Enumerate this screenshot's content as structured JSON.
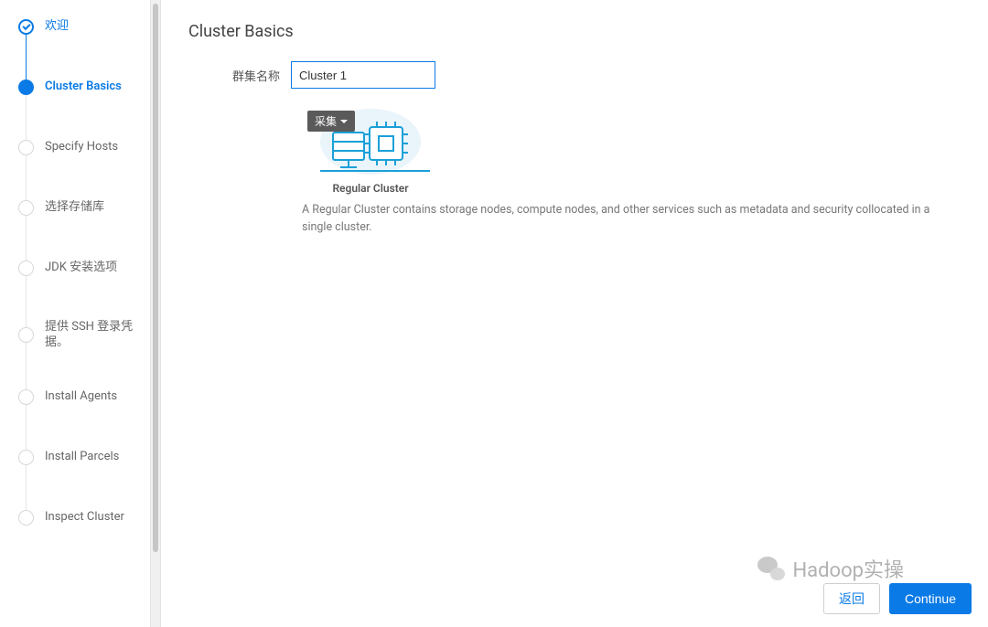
{
  "sidebar": {
    "steps": [
      {
        "label": "欢迎",
        "state": "completed"
      },
      {
        "label": "Cluster Basics",
        "state": "active"
      },
      {
        "label": "Specify Hosts",
        "state": "pending"
      },
      {
        "label": "选择存储库",
        "state": "pending"
      },
      {
        "label": "JDK 安装选项",
        "state": "pending"
      },
      {
        "label": "提供 SSH 登录凭据。",
        "state": "pending"
      },
      {
        "label": "Install Agents",
        "state": "pending"
      },
      {
        "label": "Install Parcels",
        "state": "pending"
      },
      {
        "label": "Inspect Cluster",
        "state": "pending"
      }
    ]
  },
  "main": {
    "title": "Cluster Basics",
    "cluster_name_label": "群集名称",
    "cluster_name_value": "Cluster 1",
    "collect_label": "采集",
    "type_title": "Regular Cluster",
    "type_desc": "A Regular Cluster contains storage nodes, compute nodes, and other services such as metadata and security collocated in a single cluster."
  },
  "footer": {
    "back": "返回",
    "continue": "Continue"
  },
  "watermark": {
    "text": "Hadoop实操"
  }
}
